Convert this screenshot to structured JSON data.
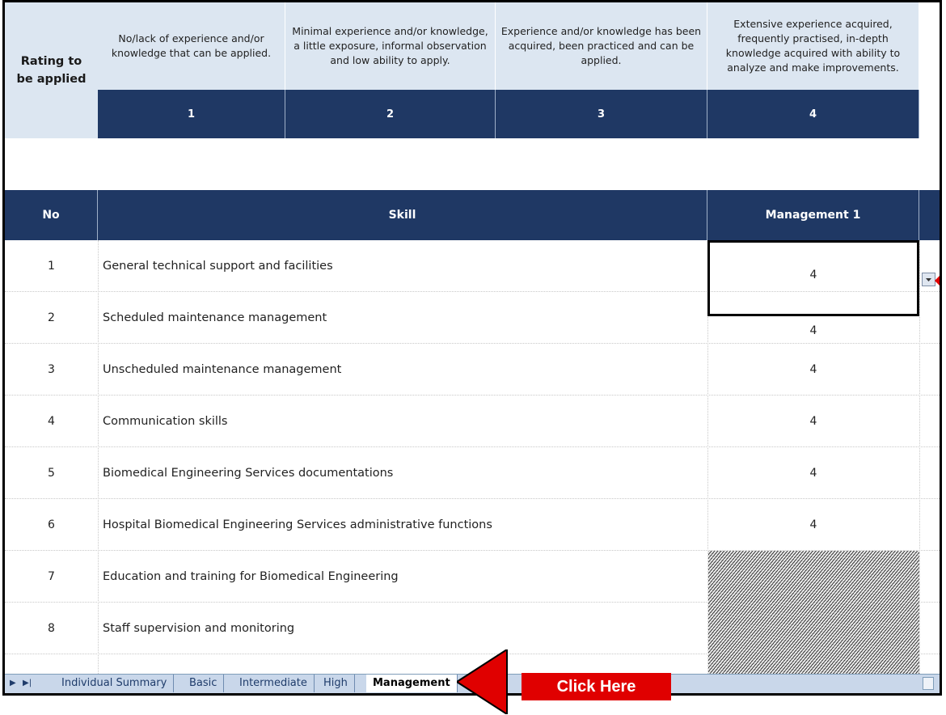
{
  "rating": {
    "label": "Rating  to be applied",
    "levels": [
      {
        "desc": "No/lack of experience and/or knowledge that can be applied.",
        "value": "1"
      },
      {
        "desc": "Minimal experience and/or knowledge, a little exposure, informal observation and low ability to apply.",
        "value": "2"
      },
      {
        "desc": "Experience and/or knowledge has been acquired, been practiced and can be applied.",
        "value": "3"
      },
      {
        "desc": "Extensive experience acquired, frequently practised, in-depth knowledge acquired with ability to analyze and make improvements.",
        "value": "4"
      }
    ]
  },
  "table": {
    "col_no": "No",
    "col_skill": "Skill",
    "col_mgmt": "Management 1",
    "rows": [
      {
        "no": "1",
        "skill": "General technical support and facilities",
        "value": "4"
      },
      {
        "no": "2",
        "skill": "Scheduled maintenance management",
        "value": "4"
      },
      {
        "no": "3",
        "skill": "Unscheduled maintenance management",
        "value": "4"
      },
      {
        "no": "4",
        "skill": "Communication skills",
        "value": "4"
      },
      {
        "no": "5",
        "skill": "Biomedical Engineering Services documentations",
        "value": "4"
      },
      {
        "no": "6",
        "skill": "Hospital Biomedical Engineering Services administrative functions",
        "value": "4"
      },
      {
        "no": "7",
        "skill": "Education and training for Biomedical Engineering",
        "value": ""
      },
      {
        "no": "8",
        "skill": "Staff supervision and monitoring",
        "value": ""
      }
    ]
  },
  "tabs": [
    "Individual Summary",
    "Basic",
    "Intermediate",
    "High",
    "Management"
  ],
  "active_tab": "Management",
  "callout": "Click Here",
  "colors": {
    "header_dark": "#1f3864",
    "header_light": "#dce6f1",
    "callout": "#e00000"
  }
}
